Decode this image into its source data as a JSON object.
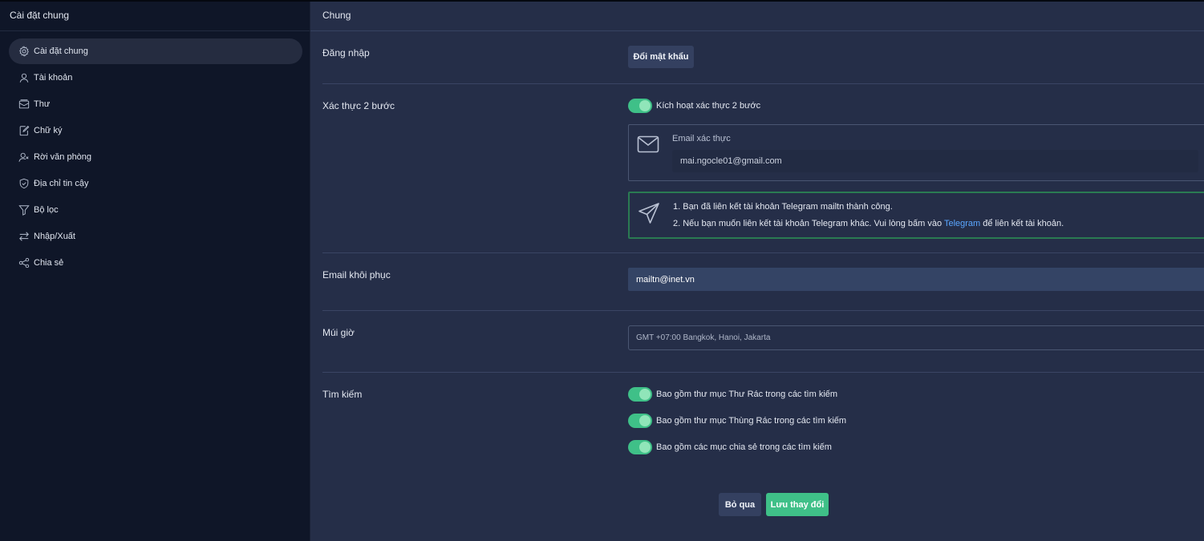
{
  "sidebar": {
    "title": "Cài đặt chung",
    "items": [
      {
        "label": "Cài đặt chung",
        "icon": "gear-icon",
        "active": true
      },
      {
        "label": "Tài khoản",
        "icon": "user-icon"
      },
      {
        "label": "Thư",
        "icon": "mail-icon"
      },
      {
        "label": "Chữ ký",
        "icon": "signature-icon"
      },
      {
        "label": "Rời văn phòng",
        "icon": "user-away-icon"
      },
      {
        "label": "Địa chỉ tin cậy",
        "icon": "shield-icon"
      },
      {
        "label": "Bộ lọc",
        "icon": "filter-icon"
      },
      {
        "label": "Nhập/Xuất",
        "icon": "import-export-icon"
      },
      {
        "label": "Chia sẻ",
        "icon": "share-icon"
      }
    ]
  },
  "main": {
    "title": "Chung",
    "login": {
      "label": "Đăng nhập",
      "change_password": "Đổi mật khẩu"
    },
    "two_factor": {
      "label": "Xác thực 2 bước",
      "toggle_label": "Kích hoạt xác thực 2 bước",
      "toggle_on": true,
      "email_label": "Email xác thực",
      "email_value": "mai.ngocle01@gmail.com",
      "telegram_line1": "1. Bạn đã liên kết tài khoản Telegram mailtn thành công.",
      "telegram_line2_prefix": "2. Nếu bạn muốn liên kết tài khoản Telegram khác. Vui lòng bấm vào",
      "telegram_link": "Telegram",
      "telegram_line2_suffix": "để liên kết tài khoản."
    },
    "recovery": {
      "label": "Email khôi phục",
      "value": "mailtn@inet.vn"
    },
    "timezone": {
      "label": "Múi giờ",
      "value": "GMT +07:00 Bangkok, Hanoi, Jakarta"
    },
    "search": {
      "label": "Tìm kiếm",
      "options": [
        {
          "label": "Bao gồm thư mục Thư Rác trong các tìm kiếm",
          "on": true
        },
        {
          "label": "Bao gồm thư mục Thùng Rác trong các tìm kiếm",
          "on": true
        },
        {
          "label": "Bao gồm các mục chia sẻ trong các tìm kiếm",
          "on": true
        }
      ]
    },
    "actions": {
      "cancel": "Bỏ qua",
      "save": "Lưu thay đổi"
    }
  },
  "colors": {
    "sidebar_bg": "#0f1628",
    "main_bg": "#252e48",
    "accent_green": "#3fc088",
    "link_blue": "#5aa6ff"
  }
}
